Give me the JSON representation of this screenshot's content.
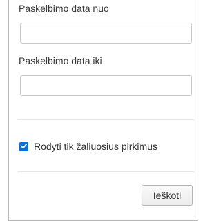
{
  "form": {
    "date_from": {
      "label": "Paskelbimo data nuo",
      "value": "",
      "placeholder": ""
    },
    "date_to": {
      "label": "Paskelbimo data iki",
      "value": "",
      "placeholder": ""
    },
    "green_only": {
      "label": "Rodyti tik žaliuosius pirkimus",
      "checked": true
    },
    "search_button_label": "Ieškoti"
  },
  "colors": {
    "checkbox_accent": "#0b6fd8",
    "border": "#c9c9c9"
  },
  "icons": {
    "checkbox": "checkmark-icon"
  }
}
